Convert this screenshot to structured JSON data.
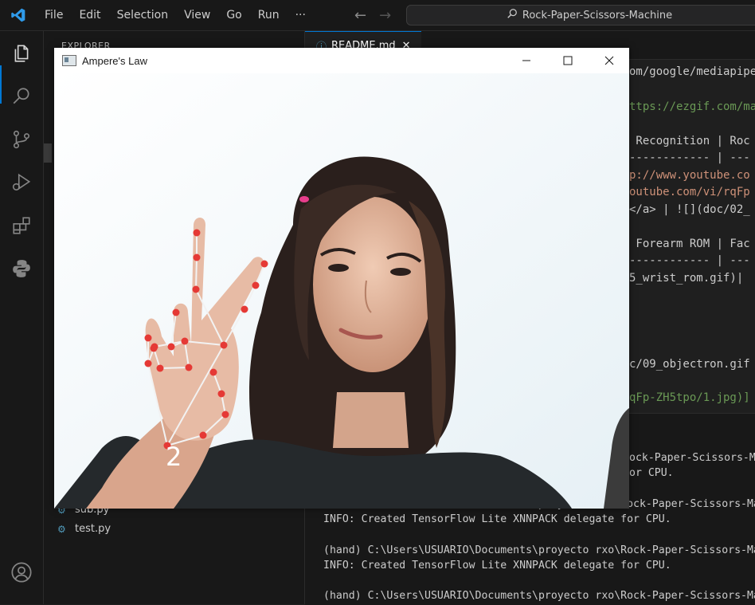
{
  "menu": [
    "File",
    "Edit",
    "Selection",
    "View",
    "Go",
    "Run",
    "···"
  ],
  "command_center": "Rock-Paper-Scissors-Machine",
  "sidebar": {
    "title": "EXPLORER",
    "files": [
      "sub.py",
      "test.py"
    ]
  },
  "editor": {
    "tab_label": "README.md",
    "lines": [
      {
        "text": "om/google/mediapipe)",
        "color": "white"
      },
      {
        "text": "ttps://ezgif.com/ma",
        "color": "green"
      },
      {
        "text": " Recognition | Roc",
        "color": "white"
      },
      {
        "text": "------------ | ---",
        "color": "white"
      },
      {
        "text": "p://www.youtube.co",
        "color": "orange"
      },
      {
        "text": "outube.com/vi/rqFp",
        "color": "orange"
      },
      {
        "text": "</a> | ![](doc/02_",
        "color": "white"
      },
      {
        "text": " Forearm ROM | Fac",
        "color": "white"
      },
      {
        "text": "------------ | ---",
        "color": "white"
      },
      {
        "text": "5_wrist_rom.gif)|",
        "color": "white"
      },
      {
        "text": "c/09_objectron.gif",
        "color": "white"
      },
      {
        "text": "qFp-ZH5tpo/1.jpg)]",
        "color": "green"
      }
    ]
  },
  "terminal": {
    "lines": [
      "ock-Paper-Scissors-Ma",
      "or CPU.",
      "",
      "(hand) C:\\Users\\USUARIO\\Documents\\proyecto rxo\\Rock-Paper-Scissors-Ma",
      "INFO: Created TensorFlow Lite XNNPACK delegate for CPU.",
      "",
      "(hand) C:\\Users\\USUARIO\\Documents\\proyecto rxo\\Rock-Paper-Scissors-Ma",
      "INFO: Created TensorFlow Lite XNNPACK delegate for CPU.",
      "",
      "(hand) C:\\Users\\USUARIO\\Documents\\proyecto rxo\\Rock-Paper-Scissors-Ma"
    ]
  },
  "cv_window": {
    "title": "Ampere's Law",
    "finger_count": "2"
  },
  "colors": {
    "accent": "#0078d4",
    "landmark": "#e53935"
  }
}
